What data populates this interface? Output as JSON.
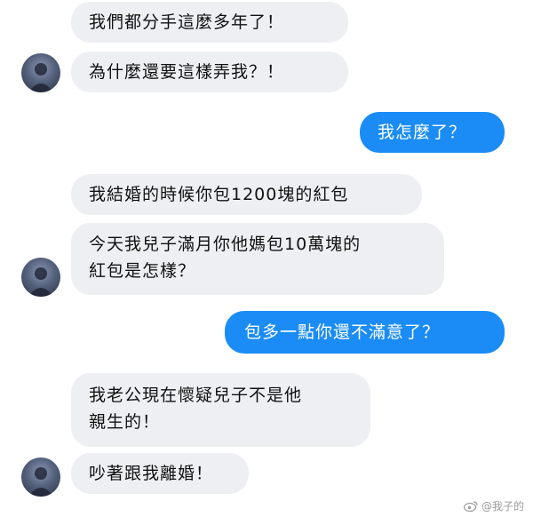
{
  "messages": [
    {
      "side": "incoming",
      "text": "我們都分手這麼多年了！"
    },
    {
      "side": "incoming",
      "text": "為什麼還要這樣弄我？！"
    },
    {
      "side": "outgoing",
      "text": "我怎麼了？"
    },
    {
      "side": "incoming",
      "text": "我結婚的時候你包1200塊的紅包"
    },
    {
      "side": "incoming",
      "text": "今天我兒子滿月你他媽包10萬塊的\n紅包是怎樣？"
    },
    {
      "side": "outgoing",
      "text": "包多一點你還不滿意了？"
    },
    {
      "side": "incoming",
      "text": "我老公現在懷疑兒子不是他\n親生的！"
    },
    {
      "side": "incoming",
      "text": "吵著跟我離婚！"
    }
  ],
  "watermark": {
    "text": "@我子的",
    "icon": "weibo-icon"
  },
  "colors": {
    "incoming_bubble": "#eeeff2",
    "outgoing_bubble": "#1b8cf5"
  }
}
